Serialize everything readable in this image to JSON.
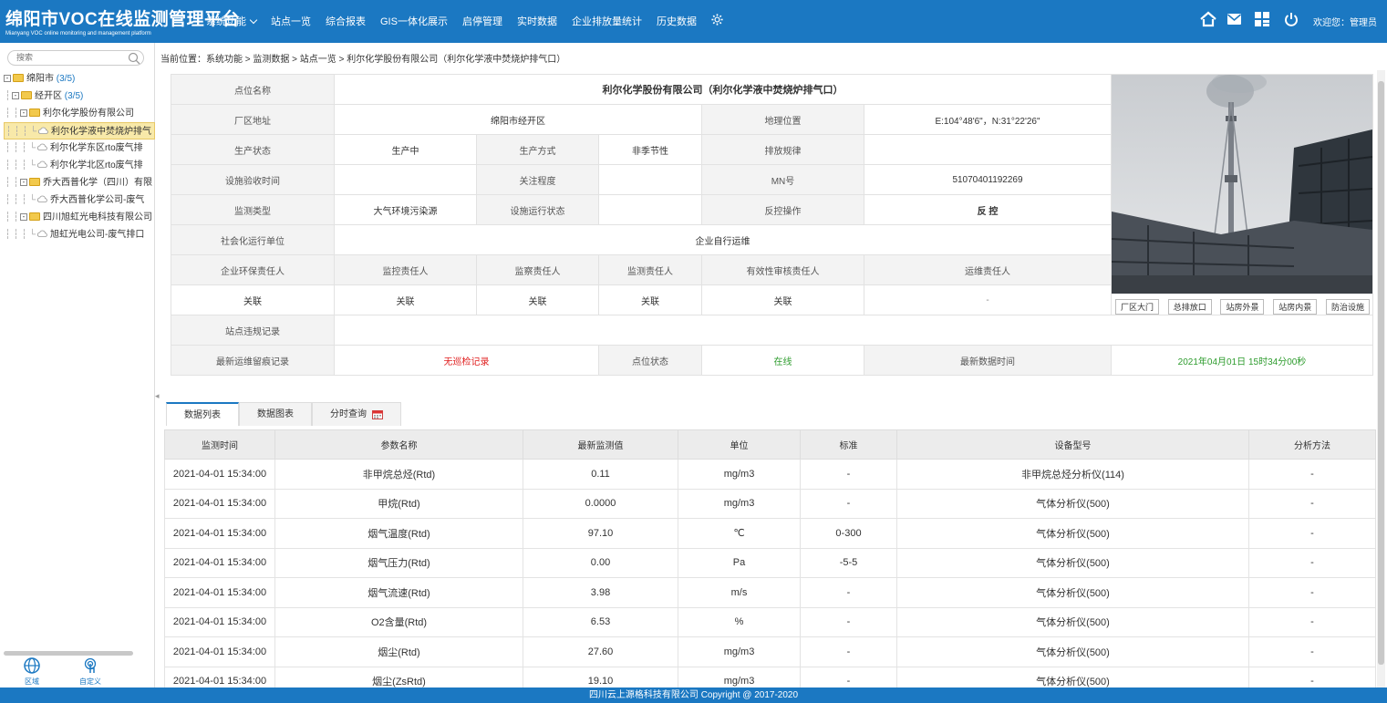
{
  "header": {
    "title": "绵阳市VOC在线监测管理平台",
    "subtitle": "Mianyang VOC online monitoring and management platform",
    "welcome": "欢迎您：管理员",
    "nav": [
      "系统功能",
      "站点一览",
      "综合报表",
      "GIS一体化展示",
      "启停管理",
      "实时数据",
      "企业排放量统计",
      "历史数据"
    ]
  },
  "sidebar": {
    "search_placeholder": "搜索",
    "tree": [
      {
        "label": "绵阳市",
        "count": "(3/5)"
      },
      {
        "label": "经开区",
        "count": "(3/5)"
      },
      {
        "label": "利尔化学股份有限公司"
      },
      {
        "label": "利尔化学液中焚烧炉排气"
      },
      {
        "label": "利尔化学东区rto废气排"
      },
      {
        "label": "利尔化学北区rto废气排"
      },
      {
        "label": "乔大西普化学（四川）有限"
      },
      {
        "label": "乔大西普化学公司-废气"
      },
      {
        "label": "四川旭虹光电科技有限公司"
      },
      {
        "label": "旭虹光电公司-废气排口"
      }
    ],
    "btn_region": "区域",
    "btn_custom": "自定义"
  },
  "breadcrumb": "当前位置：系统功能 > 监测数据 > 站点一览 > 利尔化学股份有限公司（利尔化学液中焚烧炉排气口）",
  "info": {
    "l_name": "点位名称",
    "name": "利尔化学股份有限公司（利尔化学液中焚烧炉排气口）",
    "l_addr": "厂区地址",
    "addr": "绵阳市经开区",
    "l_geo": "地理位置",
    "geo": "E:104°48'6\"，N:31°22'26\"",
    "l_prod": "生产状态",
    "prod": "生产中",
    "l_mode": "生产方式",
    "mode": "非季节性",
    "l_rule": "排放规律",
    "rule": "",
    "l_accept": "设施验收时间",
    "accept": "",
    "l_focus": "关注程度",
    "focus": "",
    "l_mn": "MN号",
    "mn": "51070401192269",
    "l_type": "监测类型",
    "type": "大气环境污染源",
    "l_run": "设施运行状态",
    "run": "",
    "l_ctrl": "反控操作",
    "ctrl": "反 控",
    "l_social": "社会化运行单位",
    "social": "企业自行运维",
    "r_env": "企业环保责任人",
    "r_mon": "监控责任人",
    "r_sup": "监察责任人",
    "r_mea": "监测责任人",
    "r_val": "有效性审核责任人",
    "r_ops": "运维责任人",
    "v_env": "关联",
    "v_mon": "关联",
    "v_sup": "关联",
    "v_mea": "关联",
    "v_val": "关联",
    "v_ops": "-",
    "l_viol": "站点违规记录",
    "viol": "",
    "l_maint": "最新运维留痕记录",
    "maint": "无巡检记录",
    "l_status": "点位状态",
    "status": "在线",
    "l_time": "最新数据时间",
    "time": "2021年04月01日 15时34分00秒",
    "photo_btns": [
      "厂区大门",
      "总排放口",
      "站房外景",
      "站房内景",
      "防治设施"
    ]
  },
  "tabs": [
    "数据列表",
    "数据图表",
    "分时查询"
  ],
  "table": {
    "headers": [
      "监测时间",
      "参数名称",
      "最新监测值",
      "单位",
      "标准",
      "设备型号",
      "分析方法"
    ],
    "rows": [
      [
        "2021-04-01 15:34:00",
        "非甲烷总烃(Rtd)",
        "0.11",
        "mg/m3",
        "-",
        "非甲烷总烃分析仪(114)",
        "-"
      ],
      [
        "2021-04-01 15:34:00",
        "甲烷(Rtd)",
        "0.0000",
        "mg/m3",
        "-",
        "气体分析仪(500)",
        "-"
      ],
      [
        "2021-04-01 15:34:00",
        "烟气温度(Rtd)",
        "97.10",
        "℃",
        "0-300",
        "气体分析仪(500)",
        "-"
      ],
      [
        "2021-04-01 15:34:00",
        "烟气压力(Rtd)",
        "0.00",
        "Pa",
        "-5-5",
        "气体分析仪(500)",
        "-"
      ],
      [
        "2021-04-01 15:34:00",
        "烟气流速(Rtd)",
        "3.98",
        "m/s",
        "-",
        "气体分析仪(500)",
        "-"
      ],
      [
        "2021-04-01 15:34:00",
        "O2含量(Rtd)",
        "6.53",
        "%",
        "-",
        "气体分析仪(500)",
        "-"
      ],
      [
        "2021-04-01 15:34:00",
        "烟尘(Rtd)",
        "27.60",
        "mg/m3",
        "-",
        "气体分析仪(500)",
        "-"
      ],
      [
        "2021-04-01 15:34:00",
        "烟尘(ZsRtd)",
        "19.10",
        "mg/m3",
        "-",
        "气体分析仪(500)",
        "-"
      ]
    ]
  },
  "footer": "四川云上源格科技有限公司 Copyright @ 2017-2020"
}
